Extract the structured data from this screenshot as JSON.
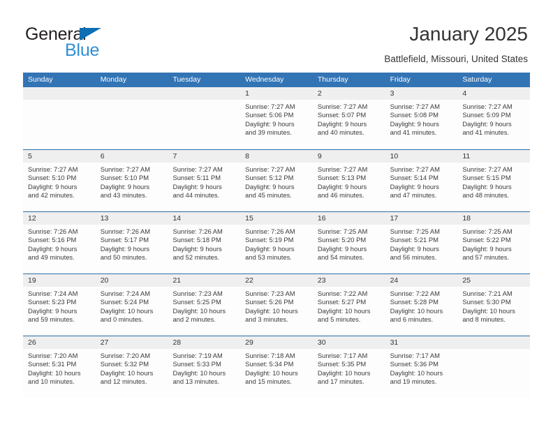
{
  "brand": {
    "name_top": "General",
    "name_bottom": "Blue",
    "accent_color": "#2f8fd4",
    "triangle_color": "#0f6fb5"
  },
  "header": {
    "title": "January 2025",
    "subtitle": "Battlefield, Missouri, United States"
  },
  "calendar": {
    "header_color": "#3374b5",
    "day_strip_color": "#efefef",
    "weekdays": [
      "Sunday",
      "Monday",
      "Tuesday",
      "Wednesday",
      "Thursday",
      "Friday",
      "Saturday"
    ],
    "weeks": [
      [
        {
          "day": "",
          "sunrise": "",
          "sunset": "",
          "daylight_line1": "",
          "daylight_line2": ""
        },
        {
          "day": "",
          "sunrise": "",
          "sunset": "",
          "daylight_line1": "",
          "daylight_line2": ""
        },
        {
          "day": "",
          "sunrise": "",
          "sunset": "",
          "daylight_line1": "",
          "daylight_line2": ""
        },
        {
          "day": "1",
          "sunrise": "Sunrise: 7:27 AM",
          "sunset": "Sunset: 5:06 PM",
          "daylight_line1": "Daylight: 9 hours",
          "daylight_line2": "and 39 minutes."
        },
        {
          "day": "2",
          "sunrise": "Sunrise: 7:27 AM",
          "sunset": "Sunset: 5:07 PM",
          "daylight_line1": "Daylight: 9 hours",
          "daylight_line2": "and 40 minutes."
        },
        {
          "day": "3",
          "sunrise": "Sunrise: 7:27 AM",
          "sunset": "Sunset: 5:08 PM",
          "daylight_line1": "Daylight: 9 hours",
          "daylight_line2": "and 41 minutes."
        },
        {
          "day": "4",
          "sunrise": "Sunrise: 7:27 AM",
          "sunset": "Sunset: 5:09 PM",
          "daylight_line1": "Daylight: 9 hours",
          "daylight_line2": "and 41 minutes."
        }
      ],
      [
        {
          "day": "5",
          "sunrise": "Sunrise: 7:27 AM",
          "sunset": "Sunset: 5:10 PM",
          "daylight_line1": "Daylight: 9 hours",
          "daylight_line2": "and 42 minutes."
        },
        {
          "day": "6",
          "sunrise": "Sunrise: 7:27 AM",
          "sunset": "Sunset: 5:10 PM",
          "daylight_line1": "Daylight: 9 hours",
          "daylight_line2": "and 43 minutes."
        },
        {
          "day": "7",
          "sunrise": "Sunrise: 7:27 AM",
          "sunset": "Sunset: 5:11 PM",
          "daylight_line1": "Daylight: 9 hours",
          "daylight_line2": "and 44 minutes."
        },
        {
          "day": "8",
          "sunrise": "Sunrise: 7:27 AM",
          "sunset": "Sunset: 5:12 PM",
          "daylight_line1": "Daylight: 9 hours",
          "daylight_line2": "and 45 minutes."
        },
        {
          "day": "9",
          "sunrise": "Sunrise: 7:27 AM",
          "sunset": "Sunset: 5:13 PM",
          "daylight_line1": "Daylight: 9 hours",
          "daylight_line2": "and 46 minutes."
        },
        {
          "day": "10",
          "sunrise": "Sunrise: 7:27 AM",
          "sunset": "Sunset: 5:14 PM",
          "daylight_line1": "Daylight: 9 hours",
          "daylight_line2": "and 47 minutes."
        },
        {
          "day": "11",
          "sunrise": "Sunrise: 7:27 AM",
          "sunset": "Sunset: 5:15 PM",
          "daylight_line1": "Daylight: 9 hours",
          "daylight_line2": "and 48 minutes."
        }
      ],
      [
        {
          "day": "12",
          "sunrise": "Sunrise: 7:26 AM",
          "sunset": "Sunset: 5:16 PM",
          "daylight_line1": "Daylight: 9 hours",
          "daylight_line2": "and 49 minutes."
        },
        {
          "day": "13",
          "sunrise": "Sunrise: 7:26 AM",
          "sunset": "Sunset: 5:17 PM",
          "daylight_line1": "Daylight: 9 hours",
          "daylight_line2": "and 50 minutes."
        },
        {
          "day": "14",
          "sunrise": "Sunrise: 7:26 AM",
          "sunset": "Sunset: 5:18 PM",
          "daylight_line1": "Daylight: 9 hours",
          "daylight_line2": "and 52 minutes."
        },
        {
          "day": "15",
          "sunrise": "Sunrise: 7:26 AM",
          "sunset": "Sunset: 5:19 PM",
          "daylight_line1": "Daylight: 9 hours",
          "daylight_line2": "and 53 minutes."
        },
        {
          "day": "16",
          "sunrise": "Sunrise: 7:25 AM",
          "sunset": "Sunset: 5:20 PM",
          "daylight_line1": "Daylight: 9 hours",
          "daylight_line2": "and 54 minutes."
        },
        {
          "day": "17",
          "sunrise": "Sunrise: 7:25 AM",
          "sunset": "Sunset: 5:21 PM",
          "daylight_line1": "Daylight: 9 hours",
          "daylight_line2": "and 56 minutes."
        },
        {
          "day": "18",
          "sunrise": "Sunrise: 7:25 AM",
          "sunset": "Sunset: 5:22 PM",
          "daylight_line1": "Daylight: 9 hours",
          "daylight_line2": "and 57 minutes."
        }
      ],
      [
        {
          "day": "19",
          "sunrise": "Sunrise: 7:24 AM",
          "sunset": "Sunset: 5:23 PM",
          "daylight_line1": "Daylight: 9 hours",
          "daylight_line2": "and 59 minutes."
        },
        {
          "day": "20",
          "sunrise": "Sunrise: 7:24 AM",
          "sunset": "Sunset: 5:24 PM",
          "daylight_line1": "Daylight: 10 hours",
          "daylight_line2": "and 0 minutes."
        },
        {
          "day": "21",
          "sunrise": "Sunrise: 7:23 AM",
          "sunset": "Sunset: 5:25 PM",
          "daylight_line1": "Daylight: 10 hours",
          "daylight_line2": "and 2 minutes."
        },
        {
          "day": "22",
          "sunrise": "Sunrise: 7:23 AM",
          "sunset": "Sunset: 5:26 PM",
          "daylight_line1": "Daylight: 10 hours",
          "daylight_line2": "and 3 minutes."
        },
        {
          "day": "23",
          "sunrise": "Sunrise: 7:22 AM",
          "sunset": "Sunset: 5:27 PM",
          "daylight_line1": "Daylight: 10 hours",
          "daylight_line2": "and 5 minutes."
        },
        {
          "day": "24",
          "sunrise": "Sunrise: 7:22 AM",
          "sunset": "Sunset: 5:28 PM",
          "daylight_line1": "Daylight: 10 hours",
          "daylight_line2": "and 6 minutes."
        },
        {
          "day": "25",
          "sunrise": "Sunrise: 7:21 AM",
          "sunset": "Sunset: 5:30 PM",
          "daylight_line1": "Daylight: 10 hours",
          "daylight_line2": "and 8 minutes."
        }
      ],
      [
        {
          "day": "26",
          "sunrise": "Sunrise: 7:20 AM",
          "sunset": "Sunset: 5:31 PM",
          "daylight_line1": "Daylight: 10 hours",
          "daylight_line2": "and 10 minutes."
        },
        {
          "day": "27",
          "sunrise": "Sunrise: 7:20 AM",
          "sunset": "Sunset: 5:32 PM",
          "daylight_line1": "Daylight: 10 hours",
          "daylight_line2": "and 12 minutes."
        },
        {
          "day": "28",
          "sunrise": "Sunrise: 7:19 AM",
          "sunset": "Sunset: 5:33 PM",
          "daylight_line1": "Daylight: 10 hours",
          "daylight_line2": "and 13 minutes."
        },
        {
          "day": "29",
          "sunrise": "Sunrise: 7:18 AM",
          "sunset": "Sunset: 5:34 PM",
          "daylight_line1": "Daylight: 10 hours",
          "daylight_line2": "and 15 minutes."
        },
        {
          "day": "30",
          "sunrise": "Sunrise: 7:17 AM",
          "sunset": "Sunset: 5:35 PM",
          "daylight_line1": "Daylight: 10 hours",
          "daylight_line2": "and 17 minutes."
        },
        {
          "day": "31",
          "sunrise": "Sunrise: 7:17 AM",
          "sunset": "Sunset: 5:36 PM",
          "daylight_line1": "Daylight: 10 hours",
          "daylight_line2": "and 19 minutes."
        },
        {
          "day": "",
          "sunrise": "",
          "sunset": "",
          "daylight_line1": "",
          "daylight_line2": ""
        }
      ]
    ]
  }
}
